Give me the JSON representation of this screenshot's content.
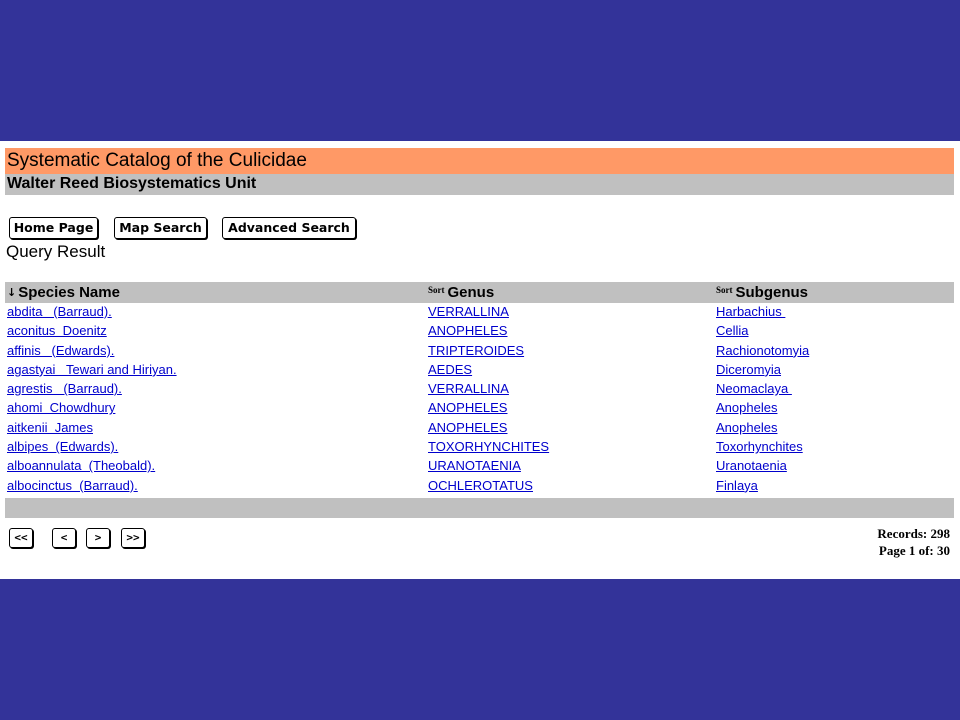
{
  "header": {
    "title": "Systematic Catalog of the Culicidae",
    "subtitle": "Walter Reed Biosystematics Unit"
  },
  "nav": {
    "home": "Home Page",
    "map": "Map Search",
    "advanced": "Advanced Search"
  },
  "query_label": "Query Result",
  "table": {
    "sort_icon": "A-Z sort icon",
    "sort_tag": "Sort",
    "columns": [
      "Species Name",
      "Genus",
      "Subgenus"
    ],
    "rows": [
      [
        "abdita   (Barraud).",
        "VERRALLINA",
        "Harbachius "
      ],
      [
        "aconitus  Doenitz",
        "ANOPHELES",
        "Cellia"
      ],
      [
        "affinis   (Edwards).",
        "TRIPTEROIDES",
        "Rachionotomyia"
      ],
      [
        "agastyai   Tewari and Hiriyan.",
        "AEDES",
        "Diceromyia"
      ],
      [
        "agrestis   (Barraud).",
        "VERRALLINA",
        "Neomaclaya "
      ],
      [
        "ahomi  Chowdhury",
        "ANOPHELES",
        "Anopheles"
      ],
      [
        "aitkenii  James",
        "ANOPHELES",
        "Anopheles"
      ],
      [
        "albipes  (Edwards).",
        "TOXORHYNCHITES",
        "Toxorhynchites"
      ],
      [
        "alboannulata  (Theobald).",
        "URANOTAENIA",
        "Uranotaenia"
      ],
      [
        "albocinctus  (Barraud).",
        "OCHLEROTATUS",
        "Finlaya"
      ]
    ]
  },
  "pager": {
    "first": "<<",
    "prev": "<",
    "next": ">",
    "last": ">>",
    "records": "Records: 298",
    "page": "Page 1 of: 30"
  }
}
